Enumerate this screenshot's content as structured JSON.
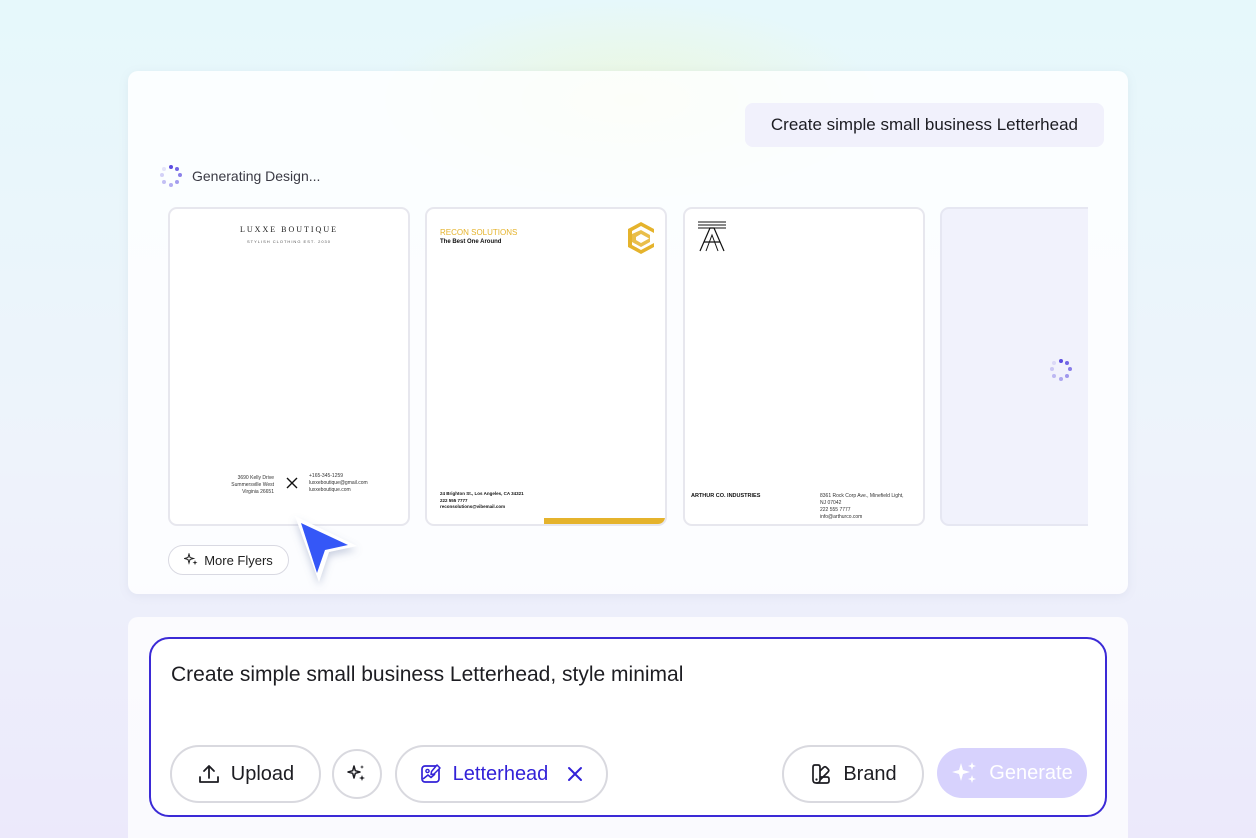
{
  "prompt_chip": {
    "text": "Create simple small business Letterhead"
  },
  "status": {
    "text": "Generating Design..."
  },
  "cards": {
    "luxe": {
      "brand": "LUXXE BOUTIQUE",
      "tagline": "STYLISH CLOTHING EST. 2030",
      "address_lines": [
        "3690 Kelly Drive",
        "Summersville West",
        "Virginia 26651"
      ],
      "contact_lines": [
        "+165-345-1259",
        "luxxeboutique@gmail.com",
        "luxxeboutique.com"
      ]
    },
    "recon": {
      "brand": "RECON SOLUTIONS",
      "tagline": "The Best One Around",
      "footer_lines": [
        "24 Brighton St., Los Angeles, CA 34321",
        "222 555 7777",
        "reconsolutions@vibemail.com"
      ],
      "accent": "#e5b32c"
    },
    "arthur": {
      "brand": "ARTHUR CO. INDUSTRIES",
      "footer_lines": [
        "8361 Rock Corp Ave., Minefield Light,",
        "NJ 07042",
        "222 555 7777",
        "info@arthurco.com"
      ]
    }
  },
  "more_button": {
    "label": "More Flyers"
  },
  "composer": {
    "text": "Create simple small business Letterhead, style minimal",
    "upload_label": "Upload",
    "tag_label": "Letterhead",
    "brand_label": "Brand",
    "generate_label": "Generate"
  },
  "colors": {
    "accent": "#3b2ad6",
    "generate_disabled": "#d7d2fd"
  },
  "icons": [
    "spinner-icon",
    "sparkle-icon",
    "upload-icon",
    "magic-icon",
    "image-edit-icon",
    "close-icon",
    "brand-palette-icon",
    "cursor-arrow-icon",
    "arthur-logo-icon",
    "recon-logo-icon"
  ]
}
